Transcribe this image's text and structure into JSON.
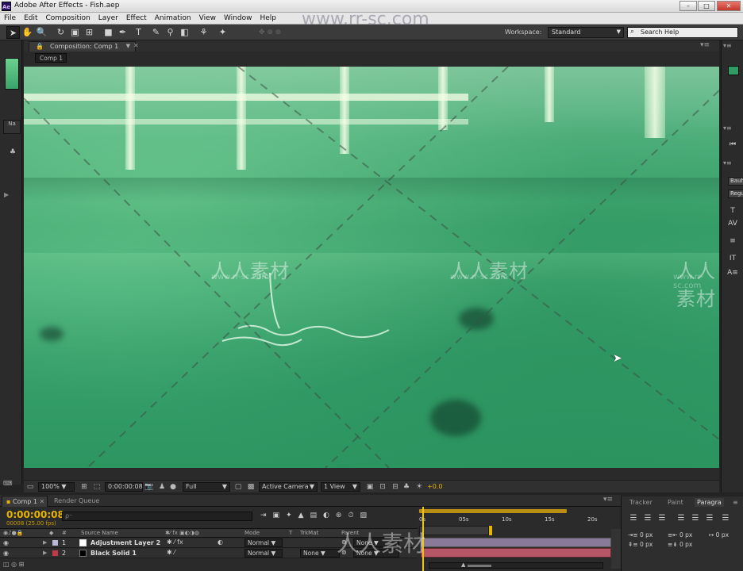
{
  "window": {
    "app_icon": "Ae",
    "title": "Adobe After Effects - Fish.aep",
    "minimize": "–",
    "maximize": "□",
    "close": "✕"
  },
  "menu": [
    "File",
    "Edit",
    "Composition",
    "Layer",
    "Effect",
    "Animation",
    "View",
    "Window",
    "Help"
  ],
  "toolbar": {
    "workspace_label": "Workspace:",
    "workspace_value": "Standard",
    "search_placeholder": "Search Help"
  },
  "composition": {
    "tab_label": "Composition: Comp 1",
    "subtab": "Comp 1"
  },
  "watermarks": {
    "url_top": "www.rr-sc.com",
    "cn": "人人素材",
    "url_small": "www.rr-sc.com"
  },
  "viewer_footer": {
    "zoom": "100%",
    "timecode": "0:00:00:08",
    "resolution": "Full",
    "camera": "Active Camera",
    "views": "1 View",
    "exposure": "+0.0"
  },
  "timeline": {
    "tabs": [
      "Comp 1",
      "Render Queue"
    ],
    "timecode": "0:00:00:08",
    "fps_info": "00008 (25.00 fps)",
    "search_placeholder": "⍴⁻",
    "headers": {
      "num": "#",
      "source_name": "Source Name",
      "mode": "Mode",
      "t": "T",
      "trkmat": "TrkMat",
      "parent": "Parent"
    },
    "ruler": [
      "0s",
      "05s",
      "10s",
      "15s",
      "20s"
    ],
    "layers": [
      {
        "num": "1",
        "name": "Adjustment Layer 2",
        "mode": "Normal",
        "trkmat": "",
        "parent": "None",
        "color": "#b9b6d6"
      },
      {
        "num": "2",
        "name": "Black Solid 1",
        "mode": "Normal",
        "trkmat": "None",
        "parent": "None",
        "color": "#c23a4a"
      }
    ]
  },
  "right_panel": {
    "btn1": "Bauh",
    "btn2": "Regu",
    "char_tabs": [
      "Tracker",
      "Paint",
      "Paragra"
    ],
    "indents": [
      "0 px",
      "0 px",
      "0 px",
      "0 px",
      "0 px"
    ]
  }
}
